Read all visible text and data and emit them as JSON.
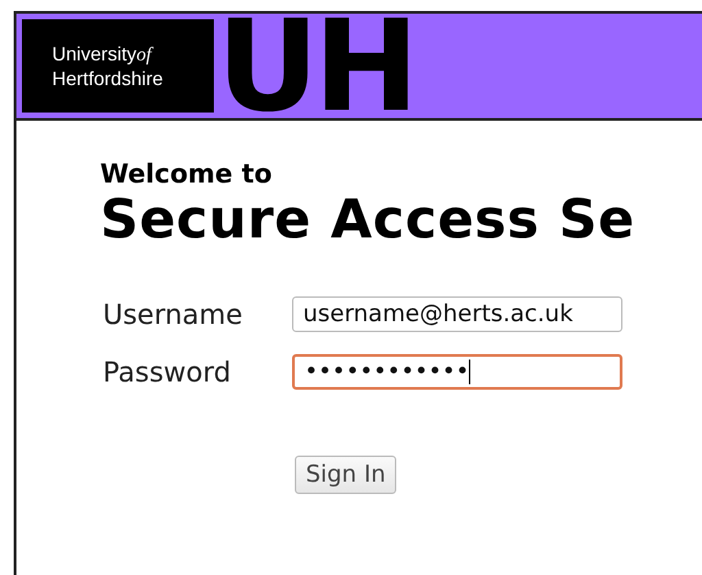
{
  "header": {
    "logo_text": [
      "University",
      "of",
      "Hertfordshire"
    ],
    "logo_mark": "UH"
  },
  "welcome": "Welcome to",
  "title": "Secure Access Se",
  "fields": [
    {
      "label": "Username",
      "value": "username@herts.ac.uk",
      "focused": false
    },
    {
      "label": "Password",
      "value": "••••••••••••",
      "focused": true
    }
  ],
  "button": "Sign In"
}
